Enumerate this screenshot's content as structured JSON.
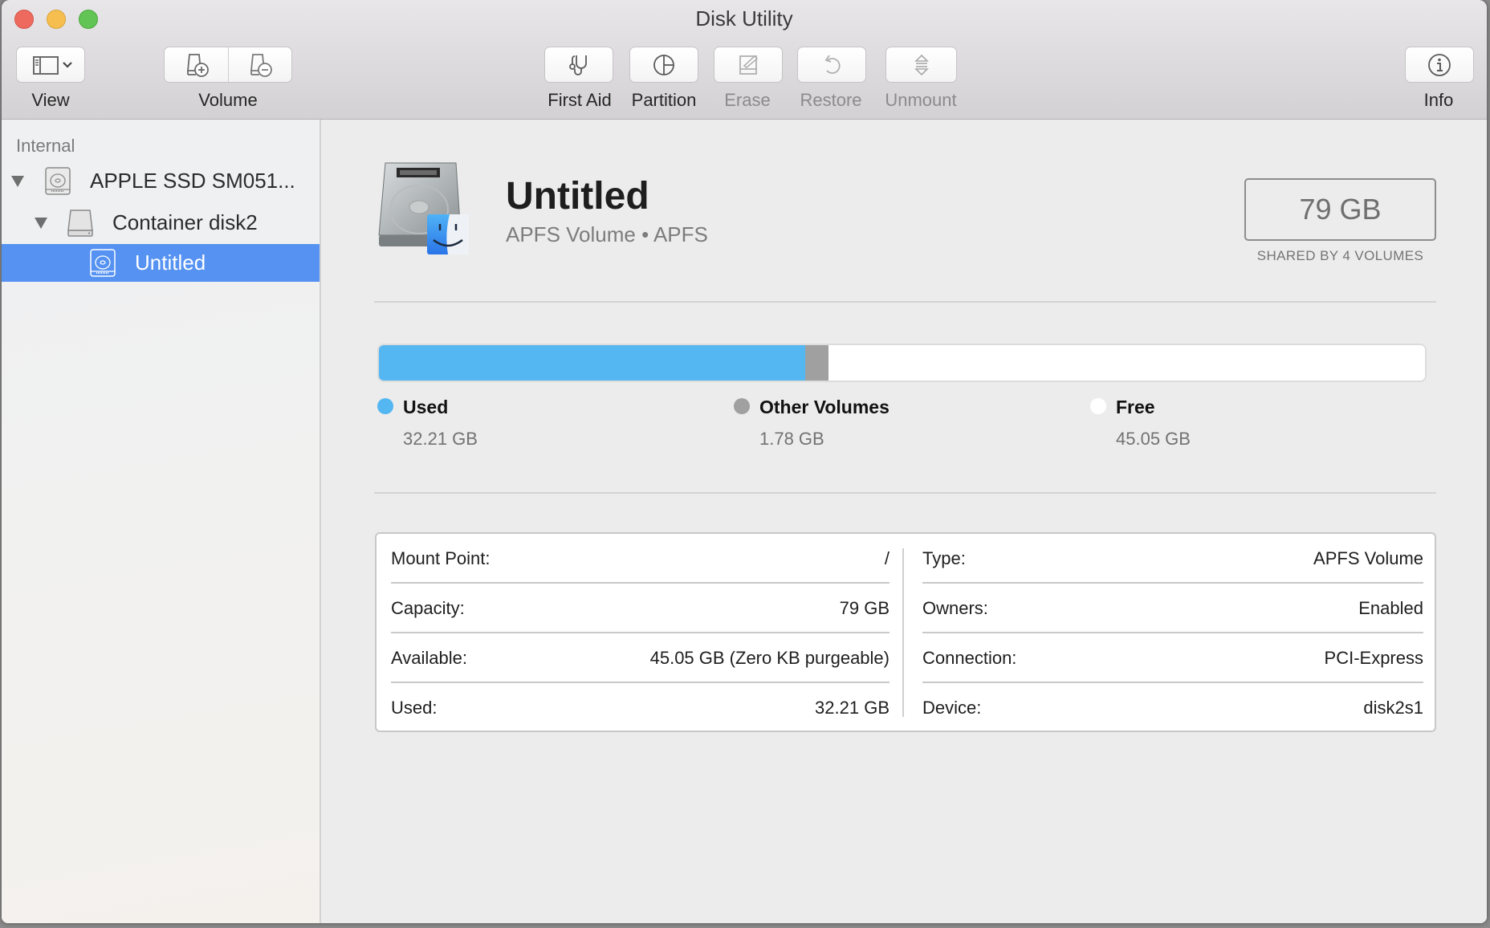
{
  "window": {
    "title": "Disk Utility"
  },
  "toolbar": {
    "view": {
      "label": "View",
      "icon": "sidebar-toggle-icon"
    },
    "volume": {
      "label": "Volume",
      "add_icon": "add-volume-icon",
      "remove_icon": "remove-volume-icon"
    },
    "first_aid": {
      "label": "First Aid",
      "icon": "stethoscope-icon",
      "enabled": true
    },
    "partition": {
      "label": "Partition",
      "icon": "pie-partition-icon",
      "enabled": true
    },
    "erase": {
      "label": "Erase",
      "icon": "erase-icon",
      "enabled": false
    },
    "restore": {
      "label": "Restore",
      "icon": "restore-icon",
      "enabled": false
    },
    "unmount": {
      "label": "Unmount",
      "icon": "eject-icon",
      "enabled": false
    },
    "info": {
      "label": "Info",
      "icon": "info-icon"
    }
  },
  "sidebar": {
    "section": "Internal",
    "items": [
      {
        "label": "APPLE SSD SM051...",
        "level": 0,
        "expanded": true,
        "icon": "internal-disk-icon",
        "selected": false
      },
      {
        "label": "Container disk2",
        "level": 1,
        "expanded": true,
        "icon": "container-disk-icon",
        "selected": false
      },
      {
        "label": "Untitled",
        "level": 2,
        "icon": "volume-disk-icon",
        "selected": true
      }
    ]
  },
  "volume": {
    "name": "Untitled",
    "subtitle": "APFS Volume • APFS",
    "capacity": "79 GB",
    "capacity_note": "SHARED BY 4 VOLUMES"
  },
  "usage": {
    "total_gb": 79,
    "segments": [
      {
        "name": "Used",
        "value": "32.21 GB",
        "gb": 32.21,
        "color": "#54b7f2"
      },
      {
        "name": "Other Volumes",
        "value": "1.78 GB",
        "gb": 1.78,
        "color": "#a0a0a0"
      },
      {
        "name": "Free",
        "value": "45.05 GB",
        "gb": 45.05,
        "color": "#ffffff"
      }
    ]
  },
  "info": {
    "left": [
      {
        "key": "Mount Point:",
        "value": "/"
      },
      {
        "key": "Capacity:",
        "value": "79 GB"
      },
      {
        "key": "Available:",
        "value": "45.05 GB (Zero KB purgeable)"
      },
      {
        "key": "Used:",
        "value": "32.21 GB"
      }
    ],
    "right": [
      {
        "key": "Type:",
        "value": "APFS Volume"
      },
      {
        "key": "Owners:",
        "value": "Enabled"
      },
      {
        "key": "Connection:",
        "value": "PCI-Express"
      },
      {
        "key": "Device:",
        "value": "disk2s1"
      }
    ]
  },
  "colors": {
    "selection": "#5592f2",
    "used": "#54b7f2",
    "other": "#a0a0a0",
    "free": "#ffffff"
  }
}
